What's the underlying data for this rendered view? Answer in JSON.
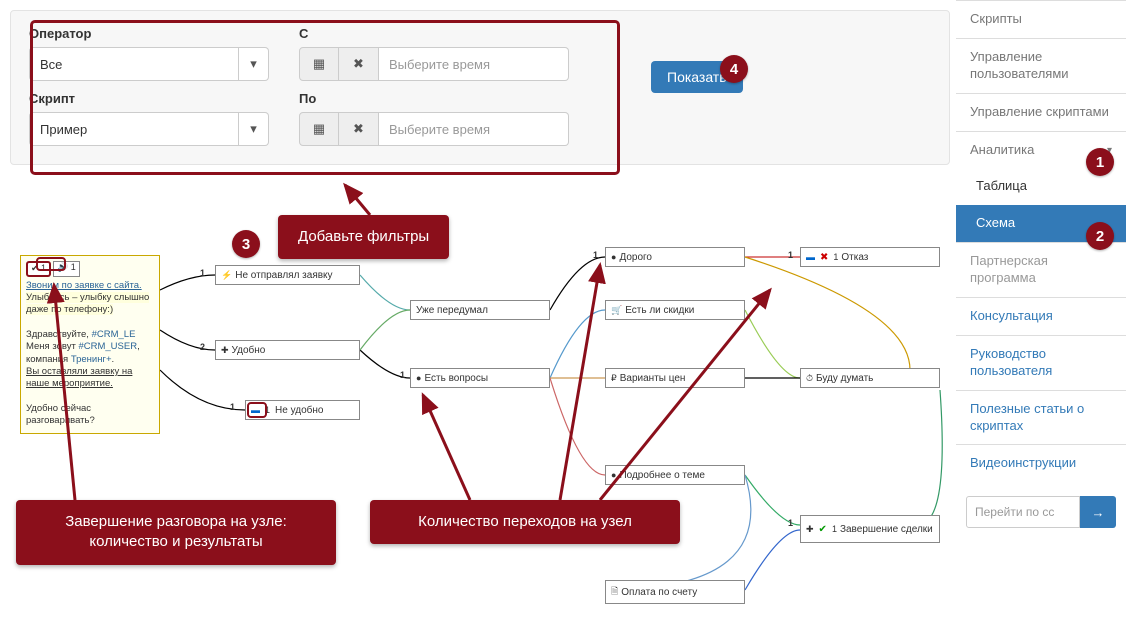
{
  "filters": {
    "operator_label": "Оператор",
    "operator_value": "Все",
    "script_label": "Скрипт",
    "script_value": "Пример",
    "from_label": "С",
    "to_label": "По",
    "time_placeholder": "Выберите время",
    "show_button": "Показать"
  },
  "sidebar": {
    "items": [
      {
        "label": "Скрипты",
        "type": "grey"
      },
      {
        "label": "Управление пользователями",
        "type": "grey"
      },
      {
        "label": "Управление скриптами",
        "type": "grey"
      },
      {
        "label": "Аналитика",
        "type": "dropdown"
      },
      {
        "label": "Таблица",
        "type": "sub"
      },
      {
        "label": "Схема",
        "type": "sub-active"
      },
      {
        "label": "Партнерская программа",
        "type": "muted"
      },
      {
        "label": "Консультация",
        "type": "link"
      },
      {
        "label": "Руководство пользователя",
        "type": "link"
      },
      {
        "label": "Полезные статьи о скриптах",
        "type": "link"
      },
      {
        "label": "Видеоинструкции",
        "type": "link"
      }
    ],
    "goto_placeholder": "Перейти по сс"
  },
  "badges": {
    "b1": "1",
    "b2": "2",
    "b3": "3",
    "b4": "4"
  },
  "callouts": {
    "c3": "Добавьте фильтры",
    "cA": "Завершение разговора на узле: количество и результаты",
    "cB": "Количество переходов на узел"
  },
  "start_node": {
    "green_badge": "✔ 1",
    "audio_badge": "🔊 1",
    "link_text": "Звоним по заявке с сайта.",
    "line1": "Улыбнись – улыбку слышно даже по телефону:)",
    "line2_a": "Здравствуйте, ",
    "crm1": "#CRM_LE",
    "line2_b": "Меня зовут ",
    "crm2": "#CRM_USER",
    "line2_c": ", компания ",
    "comp": "Тренинг+",
    "line3": "Вы оставляли заявку на наше мероприятие.",
    "line4": "Удобно сейчас разговаривать?"
  },
  "nodes": {
    "n1": "Не отправлял заявку",
    "n2": "Удобно",
    "n3": "Не удобно",
    "n4": "Уже передумал",
    "n5": "Есть вопросы",
    "n6": "Дорого",
    "n7": "Есть ли скидки",
    "n8": "Варианты цен",
    "n9": "Подробнее о теме",
    "n10": "Отказ",
    "n10_count": "1",
    "n11": "Буду думать",
    "n12": "Завершение сделки",
    "n12_count": "1",
    "n13": "Оплата по счету"
  },
  "edge_counts": {
    "e1a": "1",
    "e1b": "1",
    "e2": "2",
    "e3": "1",
    "e4": "1",
    "e5": "1",
    "e6": "1",
    "e12": "1"
  },
  "chart_data": {
    "type": "diagram",
    "nodes": [
      {
        "id": "start",
        "label": "Звоним по заявке с сайта",
        "results": {
          "success": 1,
          "audio": 1
        }
      },
      {
        "id": "n1",
        "label": "Не отправлял заявку"
      },
      {
        "id": "n2",
        "label": "Удобно"
      },
      {
        "id": "n3",
        "label": "Не удобно"
      },
      {
        "id": "n4",
        "label": "Уже передумал"
      },
      {
        "id": "n5",
        "label": "Есть вопросы"
      },
      {
        "id": "n6",
        "label": "Дорого"
      },
      {
        "id": "n7",
        "label": "Есть ли скидки"
      },
      {
        "id": "n8",
        "label": "Варианты цен"
      },
      {
        "id": "n9",
        "label": "Подробнее о теме"
      },
      {
        "id": "n10",
        "label": "Отказ",
        "count": 1,
        "terminal": "fail"
      },
      {
        "id": "n11",
        "label": "Буду думать"
      },
      {
        "id": "n12",
        "label": "Завершение сделки",
        "count": 1,
        "terminal": "success"
      },
      {
        "id": "n13",
        "label": "Оплата по счету"
      }
    ]
  }
}
